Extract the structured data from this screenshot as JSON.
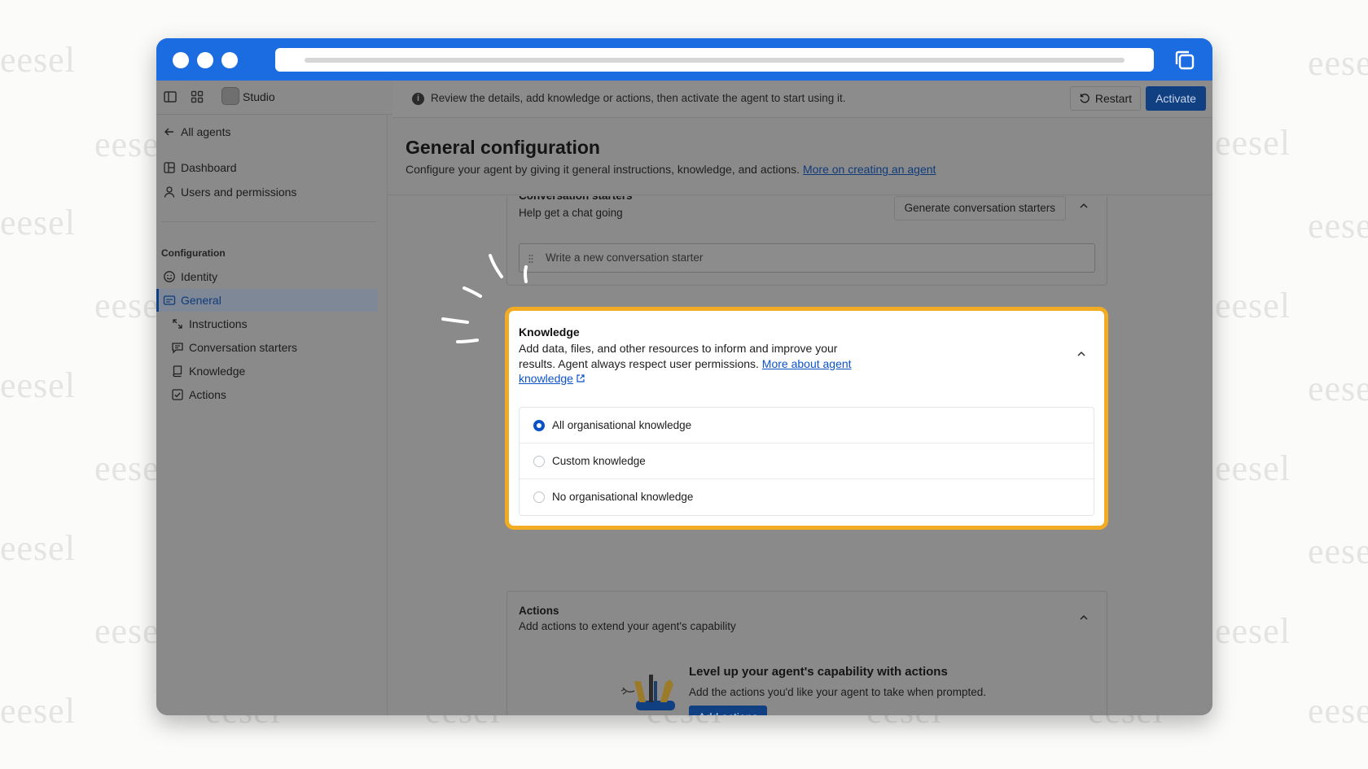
{
  "watermark": "eesel",
  "topbar": {
    "studio_label": "Studio",
    "notice": "Review the details, add knowledge or actions, then activate the agent to start using it.",
    "restart_label": "Restart",
    "activate_label": "Activate"
  },
  "sidebar": {
    "back_label": "All agents",
    "items": [
      {
        "label": "Dashboard",
        "icon": "dashboard-icon"
      },
      {
        "label": "Users and permissions",
        "icon": "user-icon"
      }
    ],
    "section_label": "Configuration",
    "config_items": [
      {
        "label": "Identity",
        "icon": "smiley-icon"
      },
      {
        "label": "General",
        "icon": "card-icon",
        "active": true
      }
    ],
    "sub_items": [
      {
        "label": "Instructions",
        "icon": "instructions-icon"
      },
      {
        "label": "Conversation starters",
        "icon": "chat-icon"
      },
      {
        "label": "Knowledge",
        "icon": "book-icon"
      },
      {
        "label": "Actions",
        "icon": "checkbox-icon"
      }
    ]
  },
  "main": {
    "title": "General configuration",
    "subtitle": "Configure your agent by giving it general instructions, knowledge, and actions.",
    "subtitle_link": "More on creating an agent",
    "starters": {
      "title": "Conversation starters",
      "desc": "Help get a chat going",
      "generate_label": "Generate conversation starters",
      "input_placeholder": "Write a new conversation starter"
    },
    "knowledge": {
      "title": "Knowledge",
      "desc": "Add data, files, and other resources to inform and improve your results. Agent always respect user permissions.",
      "link": "More about agent knowledge",
      "options": [
        {
          "label": "All organisational knowledge",
          "selected": true
        },
        {
          "label": "Custom knowledge",
          "selected": false
        },
        {
          "label": "No organisational knowledge",
          "selected": false
        }
      ]
    },
    "actions": {
      "title": "Actions",
      "desc": "Add actions to extend your agent's capability",
      "promo_title": "Level up your agent's capability with actions",
      "promo_desc": "Add the actions you'd like your agent to take when prompted.",
      "add_label": "Add actions"
    }
  },
  "colors": {
    "browser_chrome": "#1b6ce0",
    "highlight": "#f2ac24",
    "primary_button": "#103f82",
    "link": "#0c52c7"
  }
}
